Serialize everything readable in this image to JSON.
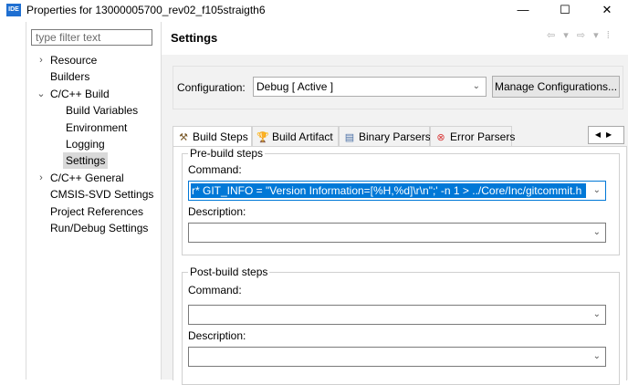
{
  "window": {
    "icon_text": "IDE",
    "title": "Properties for 13000005700_rev02_f105straigth6",
    "minimize": "—",
    "maximize": "☐",
    "close": "✕"
  },
  "filter": {
    "placeholder": "type filter text"
  },
  "tree": {
    "items": [
      {
        "label": "Resource",
        "arrow": "›",
        "depth": 0
      },
      {
        "label": "Builders",
        "arrow": "",
        "depth": 0
      },
      {
        "label": "C/C++ Build",
        "arrow": "⌄",
        "depth": 0
      },
      {
        "label": "Build Variables",
        "arrow": "",
        "depth": 1
      },
      {
        "label": "Environment",
        "arrow": "",
        "depth": 1
      },
      {
        "label": "Logging",
        "arrow": "",
        "depth": 1
      },
      {
        "label": "Settings",
        "arrow": "",
        "depth": 1,
        "selected": true
      },
      {
        "label": "C/C++ General",
        "arrow": "›",
        "depth": 0
      },
      {
        "label": "CMSIS-SVD Settings",
        "arrow": "",
        "depth": 0
      },
      {
        "label": "Project References",
        "arrow": "",
        "depth": 0
      },
      {
        "label": "Run/Debug Settings",
        "arrow": "",
        "depth": 0
      }
    ]
  },
  "settings": {
    "title": "Settings",
    "nav_icons": "⇦ ▾ ⇨ ▾ ⁞"
  },
  "configuration": {
    "label": "Configuration:",
    "selected": "Debug  [ Active ]",
    "manage_label": "Manage Configurations..."
  },
  "tabs": [
    {
      "label": "Build Steps",
      "icon": "build-steps-icon",
      "glyph": "⚒",
      "active": true
    },
    {
      "label": "Build Artifact",
      "icon": "artifact-icon",
      "glyph": "🏆",
      "active": false
    },
    {
      "label": "Binary Parsers",
      "icon": "binary-icon",
      "glyph": "▤",
      "active": false
    },
    {
      "label": "Error Parsers",
      "icon": "error-icon",
      "glyph": "⊗",
      "active": false
    }
  ],
  "tab_scroll": {
    "left": "◀",
    "right": "▶"
  },
  "pre_build": {
    "legend": "Pre-build steps",
    "command_label": "Command:",
    "command_value": "r* GIT_INFO = \"Version Information=[%H,%d]\\r\\n\";' -n 1 > ../Core/Inc/gitcommit.h",
    "description_label": "Description:",
    "description_value": ""
  },
  "post_build": {
    "legend": "Post-build steps",
    "command_label": "Command:",
    "command_value": "",
    "description_label": "Description:",
    "description_value": ""
  },
  "colors": {
    "selection": "#0078d7",
    "tree_selected": "#d9d9d9",
    "panel_bg": "#f2f2f2"
  }
}
